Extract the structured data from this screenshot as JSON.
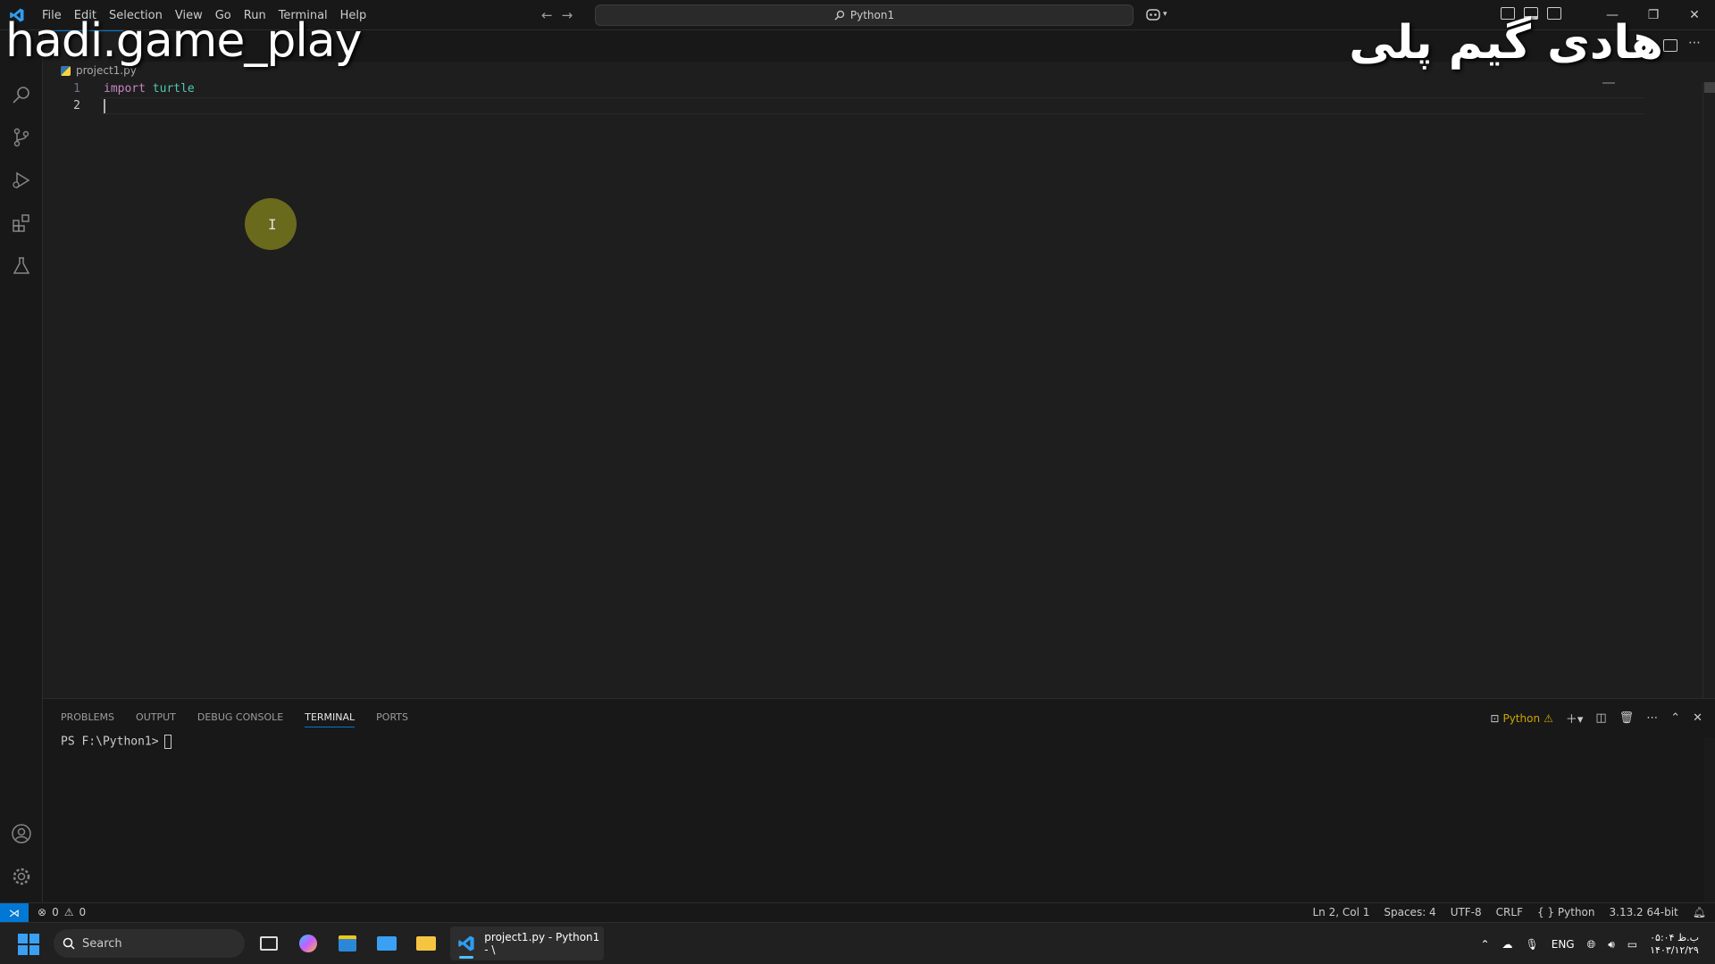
{
  "menu": [
    "File",
    "Edit",
    "Selection",
    "View",
    "Go",
    "Run",
    "Terminal",
    "Help"
  ],
  "command_center": "Python1",
  "watermark": {
    "left": "hadi.game_play",
    "right": "هادی گیم پلی"
  },
  "breadcrumb": {
    "file": "project1.py"
  },
  "editor": {
    "lines": [
      {
        "number": "1",
        "keyword": "import",
        "ident": "turtle"
      },
      {
        "number": "2",
        "keyword": "",
        "ident": ""
      }
    ]
  },
  "panel": {
    "tabs": [
      "PROBLEMS",
      "OUTPUT",
      "DEBUG CONSOLE",
      "TERMINAL",
      "PORTS"
    ],
    "active_tab": "TERMINAL",
    "terminal_name": "Python",
    "prompt": "PS F:\\Python1>"
  },
  "status": {
    "errors": "0",
    "warnings": "0",
    "position": "Ln 2, Col 1",
    "spaces": "Spaces: 4",
    "encoding": "UTF-8",
    "eol": "CRLF",
    "language": "Python",
    "interpreter": "3.13.2 64-bit"
  },
  "taskbar": {
    "search_placeholder": "Search",
    "active_window": "project1.py - Python1 - \\",
    "lang": "ENG",
    "time": "ب.ظ ۰۵:۰۴",
    "date": "۱۴۰۳/۱۲/۲۹"
  },
  "colors": {
    "accent": "#0078d4",
    "keyword": "#c586c0",
    "type": "#4ec9b0"
  }
}
